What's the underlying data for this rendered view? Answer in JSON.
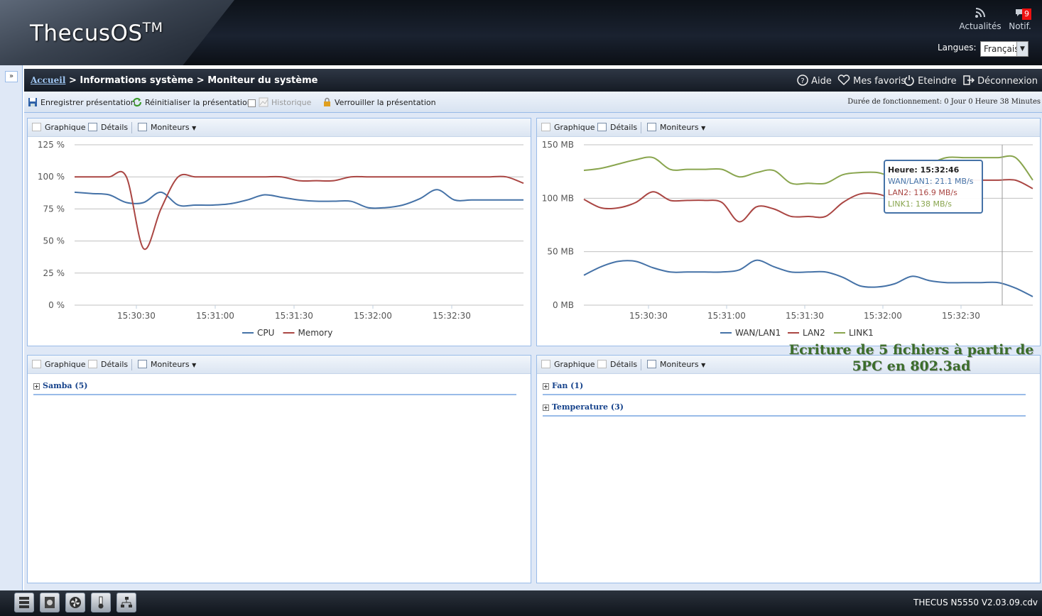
{
  "header": {
    "logo": "ThecusOS",
    "logo_tm": "TM",
    "news_label": "Actualités",
    "notif_label": "Notif.",
    "notif_count": "9",
    "language_label": "Langues:",
    "language_value": "Français"
  },
  "breadcrumb": {
    "home": "Accueil",
    "sep1": ">",
    "level2": "Informations système",
    "sep2": ">",
    "current": "Moniteur du système"
  },
  "header_actions": {
    "help": "Aide",
    "favorites": "Mes favoris",
    "shutdown": "Eteindre",
    "logout": "Déconnexion"
  },
  "toolbar": {
    "save_layout": "Enregistrer présentation",
    "reset_layout": "Réinitialiser la présentation",
    "history": "Historique",
    "lock_layout": "Verrouiller la présentation",
    "uptime": "Durée de fonctionnement:   0 Jour 0 Heure 38 Minutes"
  },
  "panel_toolbar": {
    "graph": "Graphique",
    "details": "Détails",
    "monitors": "Moniteurs"
  },
  "panels": {
    "bottom_left_group": "Samba (5)",
    "bottom_right_group1": "Fan (1)",
    "bottom_right_group2": "Temperature (3)"
  },
  "tooltip": {
    "time": "Heure: 15:32:46",
    "wan": "WAN/LAN1: 21.1 MB/s",
    "lan2": "LAN2: 116.9 MB/s",
    "link1": "LINK1: 138 MB/s"
  },
  "overlay_caption_line1": "Ecriture de 5 fichiers à partir de",
  "overlay_caption_line2": "5PC en 802.3ad",
  "footer": {
    "version": "THECUS N5550 V2.03.09.cdv"
  },
  "colors": {
    "blue": "#4572a7",
    "red": "#aa4643",
    "green": "#89a54e"
  },
  "chart_data": [
    {
      "type": "line",
      "xlabel": "",
      "ylabel": "",
      "ylim": [
        0,
        125
      ],
      "yticks": [
        "0 %",
        "25 %",
        "50 %",
        "75 %",
        "100 %",
        "125 %"
      ],
      "xticks": [
        "15:30:30",
        "15:31:00",
        "15:31:30",
        "15:32:00",
        "15:32:30"
      ],
      "legend_position": "bottom-center",
      "grid": true,
      "x_seconds": [
        0,
        10,
        20,
        30,
        40,
        50,
        60,
        70,
        80,
        90,
        100,
        110,
        120,
        130,
        140,
        150,
        160,
        170,
        180,
        190,
        200,
        210,
        220,
        230,
        240,
        250,
        260
      ],
      "series": [
        {
          "name": "CPU",
          "color": "#4572a7",
          "values": [
            88,
            87,
            86,
            80,
            80,
            88,
            78,
            78,
            78,
            79,
            82,
            86,
            84,
            82,
            81,
            81,
            81,
            76,
            76,
            78,
            83,
            90,
            82,
            82,
            82,
            82,
            82
          ]
        },
        {
          "name": "Memory",
          "color": "#aa4643",
          "values": [
            100,
            100,
            100,
            100,
            44,
            75,
            100,
            100,
            100,
            100,
            100,
            100,
            100,
            97,
            97,
            97,
            100,
            100,
            100,
            100,
            100,
            100,
            100,
            100,
            100,
            100,
            95
          ]
        }
      ]
    },
    {
      "type": "line",
      "xlabel": "",
      "ylabel": "",
      "ylim": [
        0,
        150
      ],
      "yticks": [
        "0 MB",
        "50 MB",
        "100 MB",
        "150 MB"
      ],
      "xticks": [
        "15:30:30",
        "15:31:00",
        "15:31:30",
        "15:32:00",
        "15:32:30"
      ],
      "legend_position": "bottom-center",
      "grid": true,
      "x_seconds": [
        0,
        10,
        20,
        30,
        40,
        50,
        60,
        70,
        80,
        90,
        100,
        110,
        120,
        130,
        140,
        150,
        160,
        170,
        180,
        190,
        200,
        210,
        220,
        230,
        240,
        250,
        260
      ],
      "series": [
        {
          "name": "WAN/LAN1",
          "color": "#4572a7",
          "values": [
            28,
            36,
            41,
            41,
            35,
            31,
            31,
            31,
            31,
            33,
            42,
            36,
            31,
            31,
            31,
            26,
            18,
            17,
            20,
            27,
            23,
            21.1,
            21.1,
            21.1,
            21.1,
            16,
            8
          ]
        },
        {
          "name": "LAN2",
          "color": "#aa4643",
          "values": [
            99,
            91,
            91,
            96,
            106,
            98,
            98,
            98,
            96,
            78,
            92,
            90,
            83,
            83,
            83,
            96,
            104,
            104,
            100,
            106,
            113,
            116.9,
            116.9,
            116.9,
            116.9,
            116.9,
            109
          ]
        },
        {
          "name": "LINK1",
          "color": "#89a54e",
          "values": [
            126,
            128,
            132,
            136,
            138,
            127,
            127,
            127,
            127,
            120,
            124,
            126,
            114,
            114,
            114,
            122,
            124,
            124,
            120,
            124,
            132,
            138,
            138,
            138,
            138,
            138,
            117
          ]
        }
      ]
    }
  ]
}
